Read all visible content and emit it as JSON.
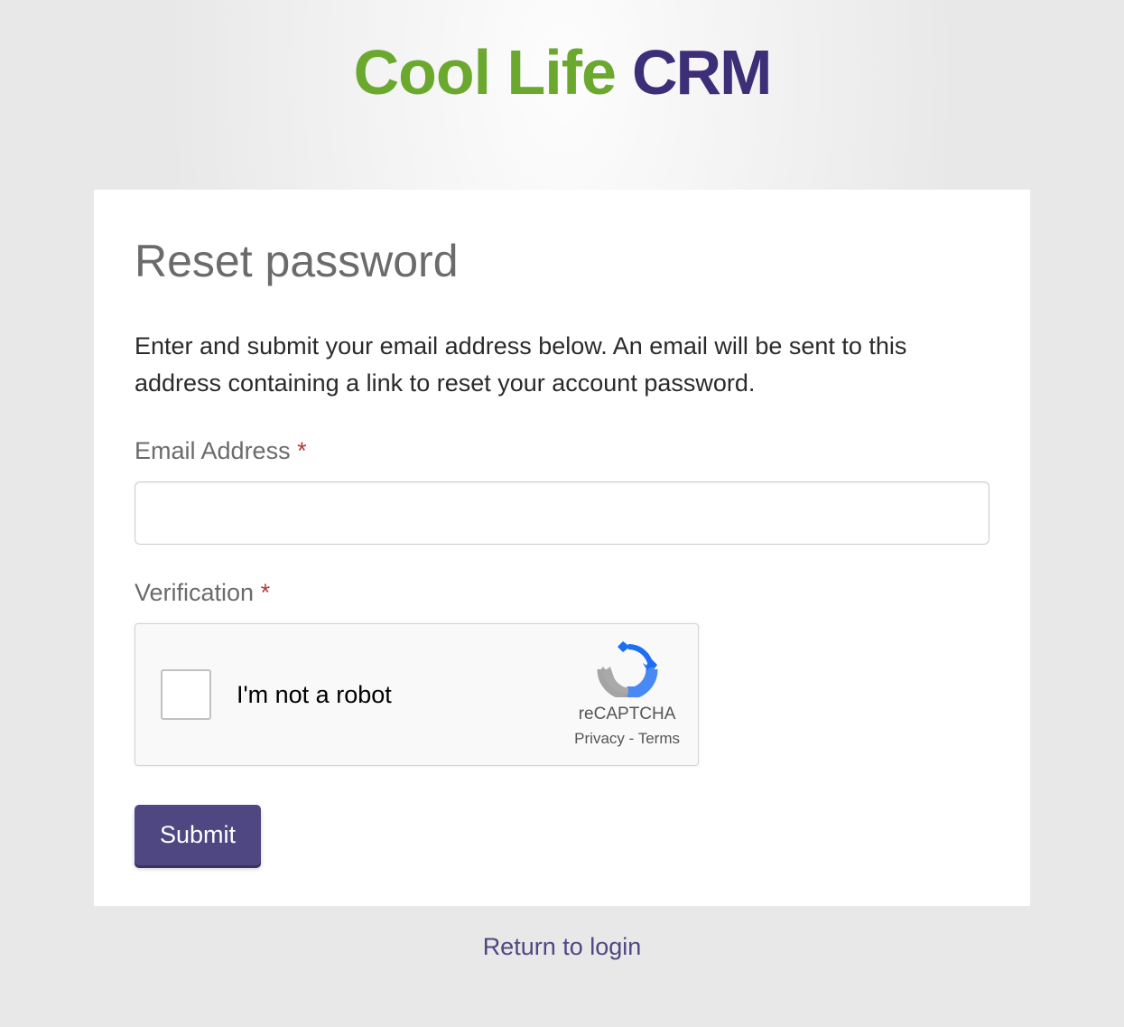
{
  "logo": {
    "part1": "Cool Life",
    "part2": "CRM"
  },
  "page": {
    "title": "Reset password",
    "description": "Enter and submit your email address below. An email will be sent to this address containing a link to reset your account password."
  },
  "form": {
    "email_label": "Email Address",
    "email_value": "",
    "verification_label": "Verification",
    "required_marker": "*",
    "submit_label": "Submit"
  },
  "recaptcha": {
    "label": "I'm not a robot",
    "brand": "reCAPTCHA",
    "privacy": "Privacy",
    "separator": " - ",
    "terms": "Terms"
  },
  "footer": {
    "return_link": "Return to login"
  }
}
